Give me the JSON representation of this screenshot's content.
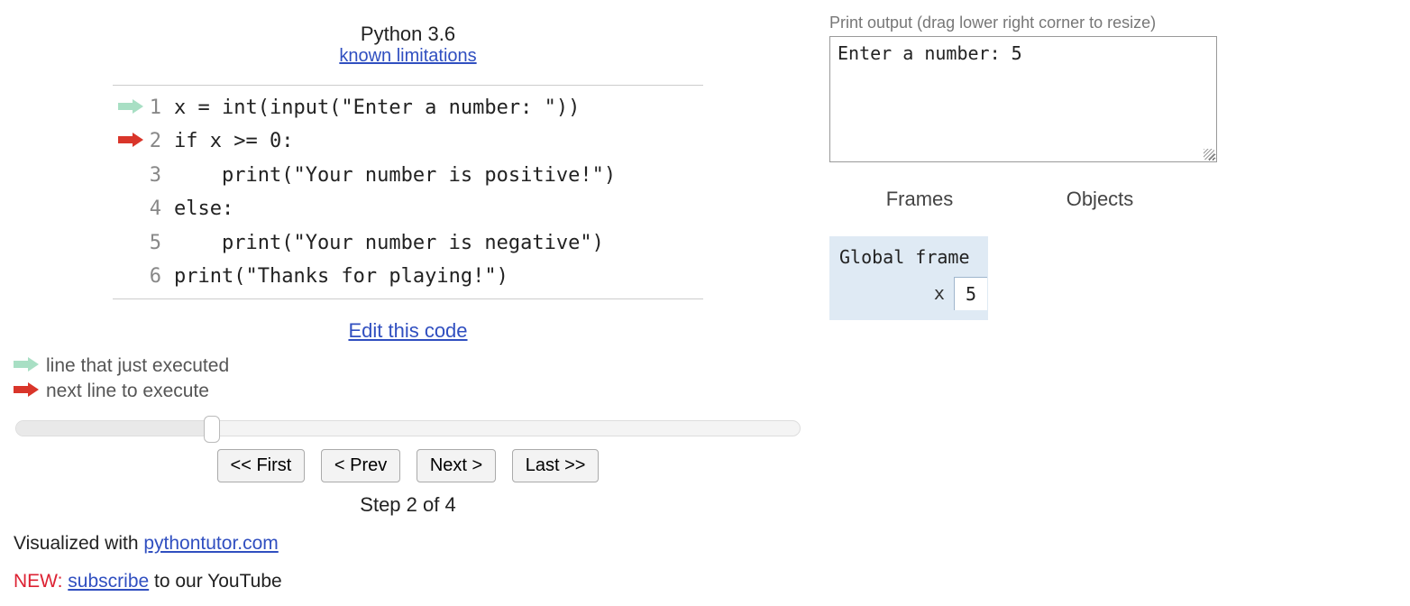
{
  "header": {
    "language": "Python 3.6",
    "limitations_link": "known limitations"
  },
  "code": {
    "lines": [
      {
        "n": 1,
        "text": "x = int(input(\"Enter a number: \"))",
        "arrow": "green"
      },
      {
        "n": 2,
        "text": "if x >= 0:",
        "arrow": "red"
      },
      {
        "n": 3,
        "text": "    print(\"Your number is positive!\")",
        "arrow": ""
      },
      {
        "n": 4,
        "text": "else:",
        "arrow": ""
      },
      {
        "n": 5,
        "text": "    print(\"Your number is negative\")",
        "arrow": ""
      },
      {
        "n": 6,
        "text": "print(\"Thanks for playing!\")",
        "arrow": ""
      }
    ]
  },
  "edit_link": "Edit this code",
  "legend": {
    "green": "line that just executed",
    "red": "next line to execute"
  },
  "slider": {
    "percent": 25
  },
  "controls": {
    "first": "<< First",
    "prev": "< Prev",
    "next": "Next >",
    "last": "Last >>"
  },
  "step_label": "Step 2 of 4",
  "footer": {
    "viz_prefix": "Visualized with ",
    "viz_link": "pythontutor.com",
    "new_tag": "NEW:",
    "subscribe_link": "subscribe",
    "subscribe_suffix": " to our YouTube"
  },
  "output": {
    "label": "Print output (drag lower right corner to resize)",
    "text": "Enter a number: 5"
  },
  "viz_headers": {
    "frames": "Frames",
    "objects": "Objects"
  },
  "global_frame": {
    "title": "Global frame",
    "vars": [
      {
        "name": "x",
        "value": "5"
      }
    ]
  }
}
